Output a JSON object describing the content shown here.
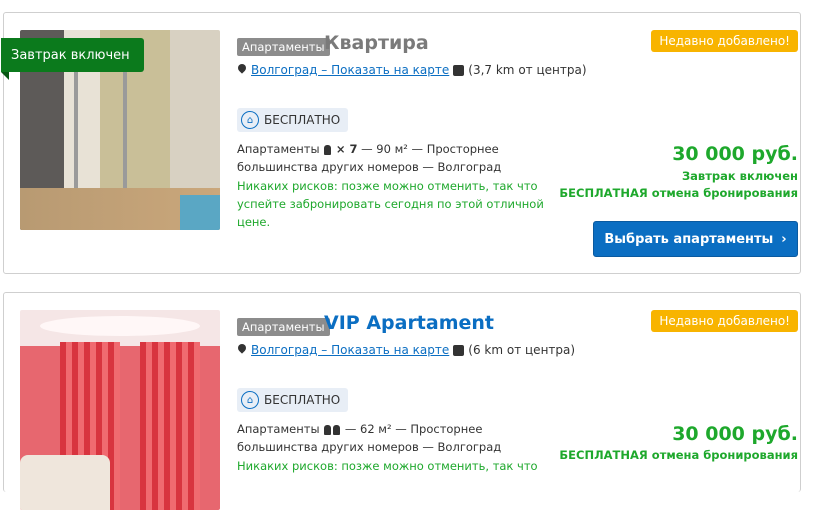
{
  "listings": [
    {
      "ribbon": "Завтрак включен",
      "type_badge": "Апартаменты",
      "title": "Квартира",
      "new_badge": "Недавно добавлено!",
      "location": "Волгоград – Показать на карте",
      "distance": "(3,7 km от центра)",
      "free_label": "БЕСПЛАТНО",
      "desc_prefix": "Апартаменты",
      "desc_guests": "× 7",
      "desc_rest": "— 90 м² — Просторнее большинства других номеров — Волгоград",
      "risk": "Никаких рисков: позже можно отменить, так что успейте забронировать сегодня по этой отличной цене.",
      "price": "30 000 руб.",
      "breakfast": "Завтрак включен",
      "cancel": "БЕСПЛАТНАЯ отмена бронирования",
      "button": "Выбрать апартаменты",
      "button_chevron": "›"
    },
    {
      "type_badge": "Апартаменты",
      "title": "VIP Apartament",
      "new_badge": "Недавно добавлено!",
      "location": "Волгоград – Показать на карте",
      "distance": "(6 km от центра)",
      "free_label": "БЕСПЛАТНО",
      "desc_prefix": "Апартаменты",
      "desc_rest": "— 62 м² — Просторнее большинства других номеров — Волгоград",
      "risk": "Никаких рисков: позже можно отменить, так что",
      "price": "30 000 руб.",
      "cancel": "БЕСПЛАТНАЯ отмена бронирования"
    }
  ],
  "colors": {
    "accent_blue": "#0b6ec2",
    "green": "#1ea82c",
    "ribbon_green": "#0b7a1c",
    "new_badge": "#f8b400"
  }
}
